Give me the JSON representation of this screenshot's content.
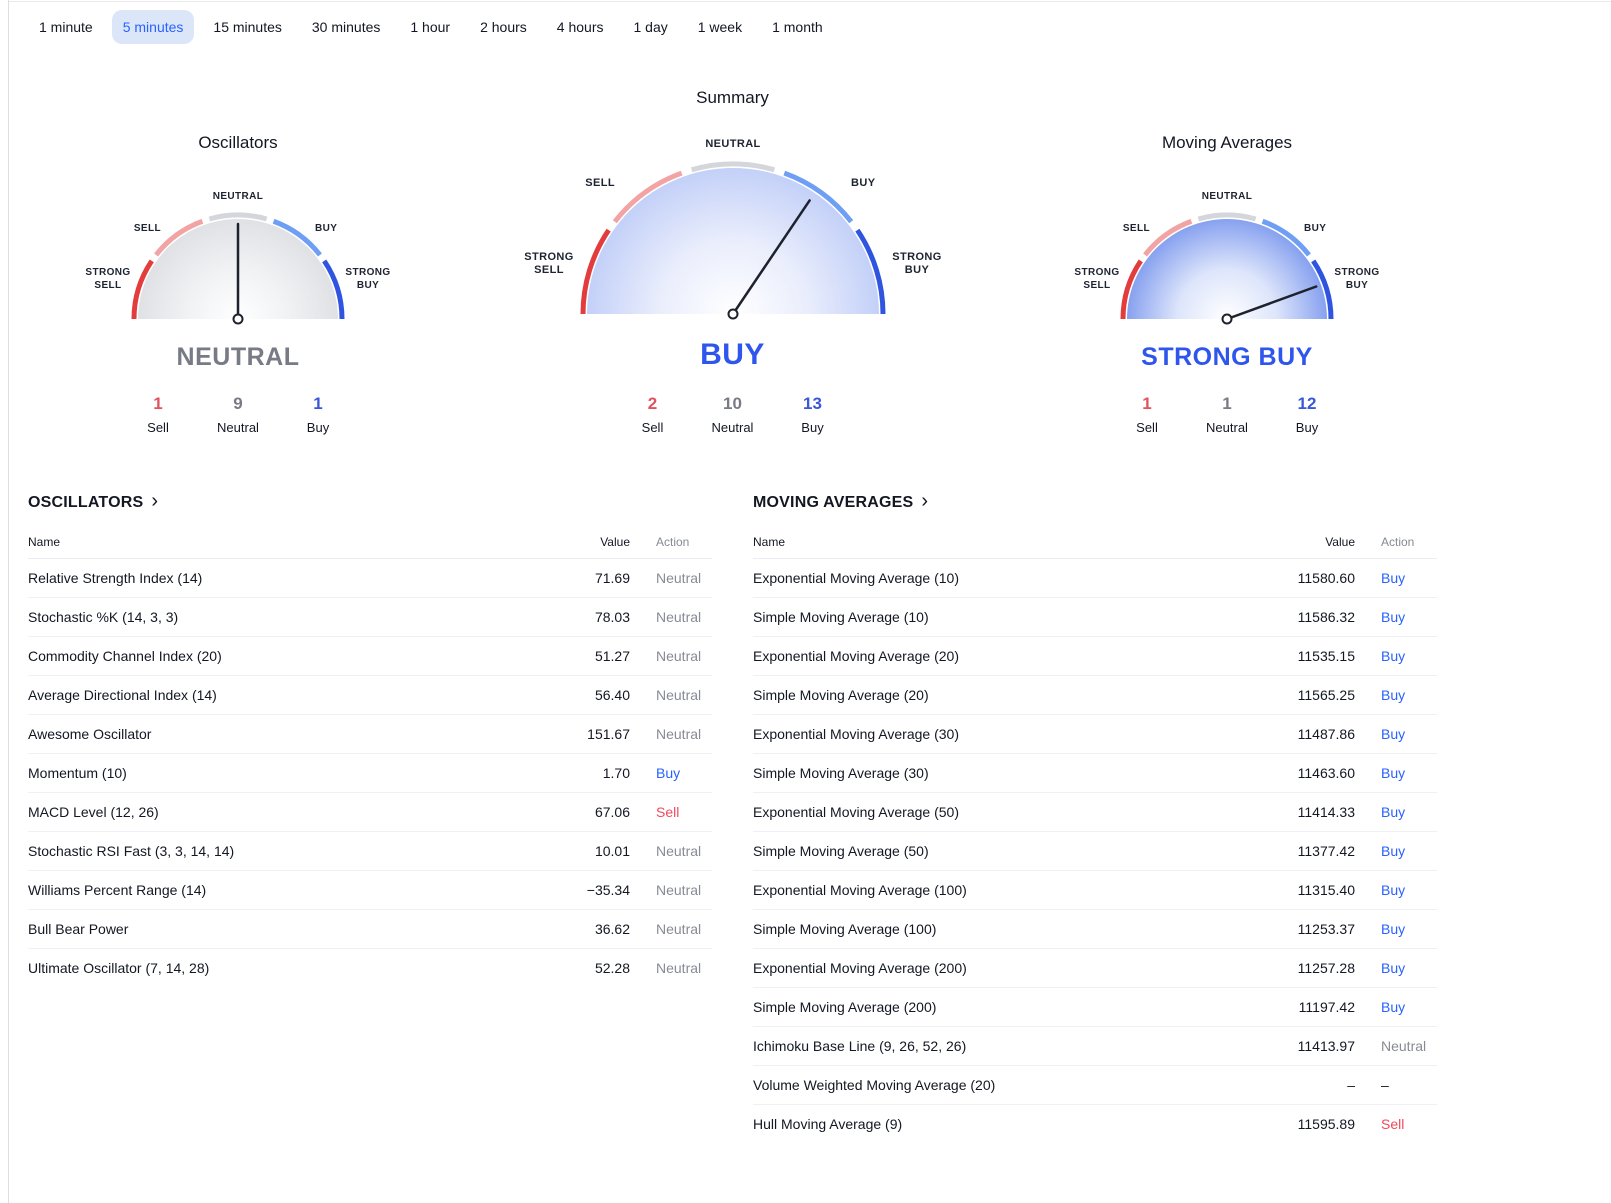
{
  "tabs": {
    "items": [
      {
        "label": "1 minute"
      },
      {
        "label": "5 minutes"
      },
      {
        "label": "15 minutes"
      },
      {
        "label": "30 minutes"
      },
      {
        "label": "1 hour"
      },
      {
        "label": "2 hours"
      },
      {
        "label": "4 hours"
      },
      {
        "label": "1 day"
      },
      {
        "label": "1 week"
      },
      {
        "label": "1 month"
      }
    ],
    "selected_index": 1,
    "selected_label": "5 minutes"
  },
  "gauge_labels": {
    "neutral": "NEUTRAL",
    "sell": "SELL",
    "buy": "BUY",
    "strong_sell_line1": "STRONG",
    "strong_sell_line2": "SELL",
    "strong_buy_line1": "STRONG",
    "strong_buy_line2": "BUY"
  },
  "count_labels": {
    "sell": "Sell",
    "neutral": "Neutral",
    "buy": "Buy"
  },
  "gauges": [
    {
      "id": "oscillators",
      "title": "Oscillators",
      "status": "NEUTRAL",
      "status_type": "neutral",
      "needle_deg": 90,
      "size": "small",
      "fill": "neutral",
      "counts": {
        "sell": "1",
        "neutral": "9",
        "buy": "1"
      }
    },
    {
      "id": "summary",
      "title": "Summary",
      "status": "BUY",
      "status_type": "buy",
      "needle_deg": 56,
      "size": "large",
      "fill": "buy",
      "counts": {
        "sell": "2",
        "neutral": "10",
        "buy": "13"
      }
    },
    {
      "id": "moving-averages",
      "title": "Moving Averages",
      "status": "STRONG BUY",
      "status_type": "buy",
      "needle_deg": 20,
      "size": "small",
      "fill": "strong_buy",
      "counts": {
        "sell": "1",
        "neutral": "1",
        "buy": "12"
      }
    }
  ],
  "tables": [
    {
      "id": "oscillators",
      "heading": "OSCILLATORS",
      "chevron": "›",
      "columns": {
        "name": "Name",
        "value": "Value",
        "action": "Action"
      },
      "rows": [
        {
          "name": "Relative Strength Index (14)",
          "value": "71.69",
          "action": "Neutral"
        },
        {
          "name": "Stochastic %K (14, 3, 3)",
          "value": "78.03",
          "action": "Neutral"
        },
        {
          "name": "Commodity Channel Index (20)",
          "value": "51.27",
          "action": "Neutral"
        },
        {
          "name": "Average Directional Index (14)",
          "value": "56.40",
          "action": "Neutral"
        },
        {
          "name": "Awesome Oscillator",
          "value": "151.67",
          "action": "Neutral"
        },
        {
          "name": "Momentum (10)",
          "value": "1.70",
          "action": "Buy"
        },
        {
          "name": "MACD Level (12, 26)",
          "value": "67.06",
          "action": "Sell"
        },
        {
          "name": "Stochastic RSI Fast (3, 3, 14, 14)",
          "value": "10.01",
          "action": "Neutral"
        },
        {
          "name": "Williams Percent Range (14)",
          "value": "−35.34",
          "action": "Neutral"
        },
        {
          "name": "Bull Bear Power",
          "value": "36.62",
          "action": "Neutral"
        },
        {
          "name": "Ultimate Oscillator (7, 14, 28)",
          "value": "52.28",
          "action": "Neutral"
        }
      ]
    },
    {
      "id": "moving-averages",
      "heading": "MOVING AVERAGES",
      "chevron": "›",
      "columns": {
        "name": "Name",
        "value": "Value",
        "action": "Action"
      },
      "rows": [
        {
          "name": "Exponential Moving Average (10)",
          "value": "11580.60",
          "action": "Buy"
        },
        {
          "name": "Simple Moving Average (10)",
          "value": "11586.32",
          "action": "Buy"
        },
        {
          "name": "Exponential Moving Average (20)",
          "value": "11535.15",
          "action": "Buy"
        },
        {
          "name": "Simple Moving Average (20)",
          "value": "11565.25",
          "action": "Buy"
        },
        {
          "name": "Exponential Moving Average (30)",
          "value": "11487.86",
          "action": "Buy"
        },
        {
          "name": "Simple Moving Average (30)",
          "value": "11463.60",
          "action": "Buy"
        },
        {
          "name": "Exponential Moving Average (50)",
          "value": "11414.33",
          "action": "Buy"
        },
        {
          "name": "Simple Moving Average (50)",
          "value": "11377.42",
          "action": "Buy"
        },
        {
          "name": "Exponential Moving Average (100)",
          "value": "11315.40",
          "action": "Buy"
        },
        {
          "name": "Simple Moving Average (100)",
          "value": "11253.37",
          "action": "Buy"
        },
        {
          "name": "Exponential Moving Average (200)",
          "value": "11257.28",
          "action": "Buy"
        },
        {
          "name": "Simple Moving Average (200)",
          "value": "11197.42",
          "action": "Buy"
        },
        {
          "name": "Ichimoku Base Line (9, 26, 52, 26)",
          "value": "11413.97",
          "action": "Neutral"
        },
        {
          "name": "Volume Weighted Moving Average (20)",
          "value": "–",
          "action": "–"
        },
        {
          "name": "Hull Moving Average (9)",
          "value": "11595.89",
          "action": "Sell"
        }
      ]
    }
  ],
  "colors": {
    "accent_buy": "#2962ff",
    "accent_sell": "#ef4a5e",
    "neutral_text": "#787b86",
    "dark_text": "#131722",
    "selected_tab_bg": "#dbe6f9",
    "arc_strong_sell": "#e23d3c",
    "arc_sell": "#f2a3a4",
    "arc_neutral": "#d4d6dc",
    "arc_buy": "#6f9ff4",
    "arc_strong_buy": "#2f55e0",
    "needle": "#1e222d"
  }
}
